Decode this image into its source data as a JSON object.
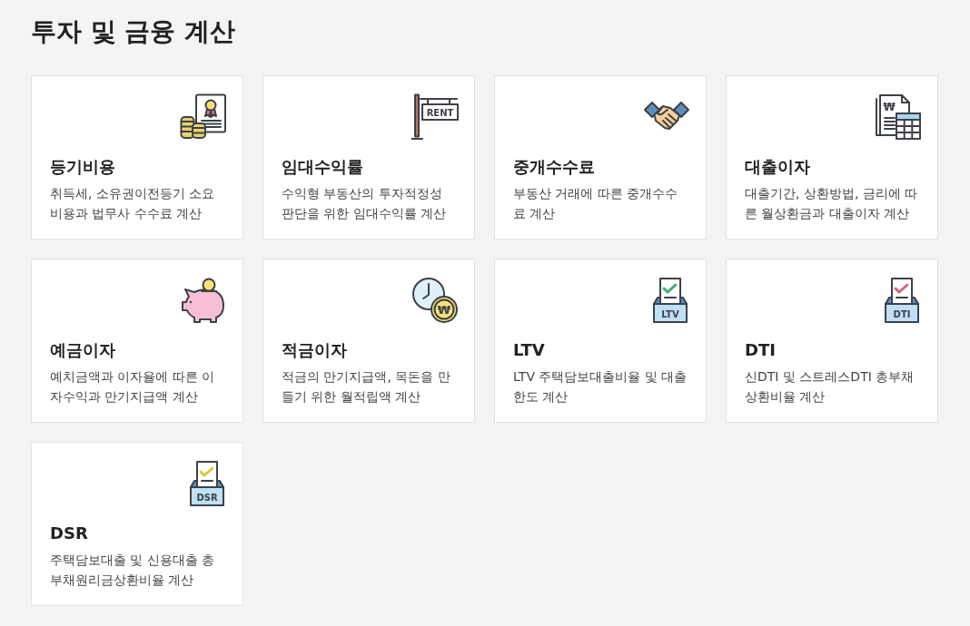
{
  "page": {
    "title": "투자 및 금융 계산"
  },
  "cards": [
    {
      "kind": "registry",
      "title": "등기비용",
      "description": "취득세, 소유권이전등기 소요비용과 법무사 수수료 계산"
    },
    {
      "kind": "rent",
      "title": "임대수익률",
      "description": "수익형 부동산의 투자적정성 판단을 위한 임대수익률 계산",
      "icon_label": "RENT"
    },
    {
      "kind": "brokerage",
      "title": "중개수수료",
      "description": "부동산 거래에 따른 중개수수료 계산"
    },
    {
      "kind": "loan",
      "title": "대출이자",
      "description": "대출기간, 상환방법, 금리에 따른 월상환금과 대출이자 계산",
      "icon_label": "₩"
    },
    {
      "kind": "deposit",
      "title": "예금이자",
      "description": "예치금액과 이자율에 따른 이자수익과 만기지급액 계산"
    },
    {
      "kind": "savings",
      "title": "적금이자",
      "description": "적금의 만기지급액, 목돈을 만들기 위한 월적립액 계산",
      "icon_label": "₩"
    },
    {
      "kind": "ballot",
      "title": "LTV",
      "description": "LTV 주택담보대출비율 및 대출한도 계산",
      "icon_label": "LTV",
      "color": "#3dab6e"
    },
    {
      "kind": "ballot",
      "title": "DTI",
      "description": "신DTI 및 스트레스DTI 총부채상환비율 계산",
      "icon_label": "DTI",
      "color": "#d9607a"
    },
    {
      "kind": "ballot",
      "title": "DSR",
      "description": "주택담보대출 및 신용대출 총부채원리금상환비율 계산",
      "icon_label": "DSR",
      "color": "#e2c23a"
    }
  ]
}
